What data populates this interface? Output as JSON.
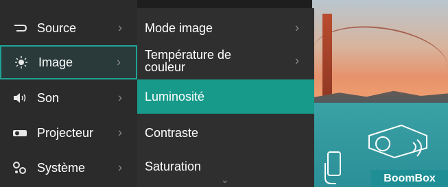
{
  "main_menu": {
    "items": [
      {
        "label": "Source",
        "icon": "source-icon",
        "selected": false
      },
      {
        "label": "Image",
        "icon": "image-icon",
        "selected": true
      },
      {
        "label": "Son",
        "icon": "speaker-icon",
        "selected": false
      },
      {
        "label": "Projecteur",
        "icon": "projector-icon",
        "selected": false
      },
      {
        "label": "Système",
        "icon": "system-icon",
        "selected": false
      }
    ]
  },
  "sub_menu": {
    "items": [
      {
        "label": "Mode image",
        "has_submenu": true
      },
      {
        "label": "Température de\ncouleur",
        "has_submenu": true
      },
      {
        "label": "Luminosité",
        "highlighted": true
      },
      {
        "label": "Contraste"
      },
      {
        "label": "Saturation"
      }
    ]
  },
  "badge": {
    "label": "BoomBox"
  },
  "colors": {
    "accent": "#179a8a",
    "selected_border": "#1fa396"
  }
}
